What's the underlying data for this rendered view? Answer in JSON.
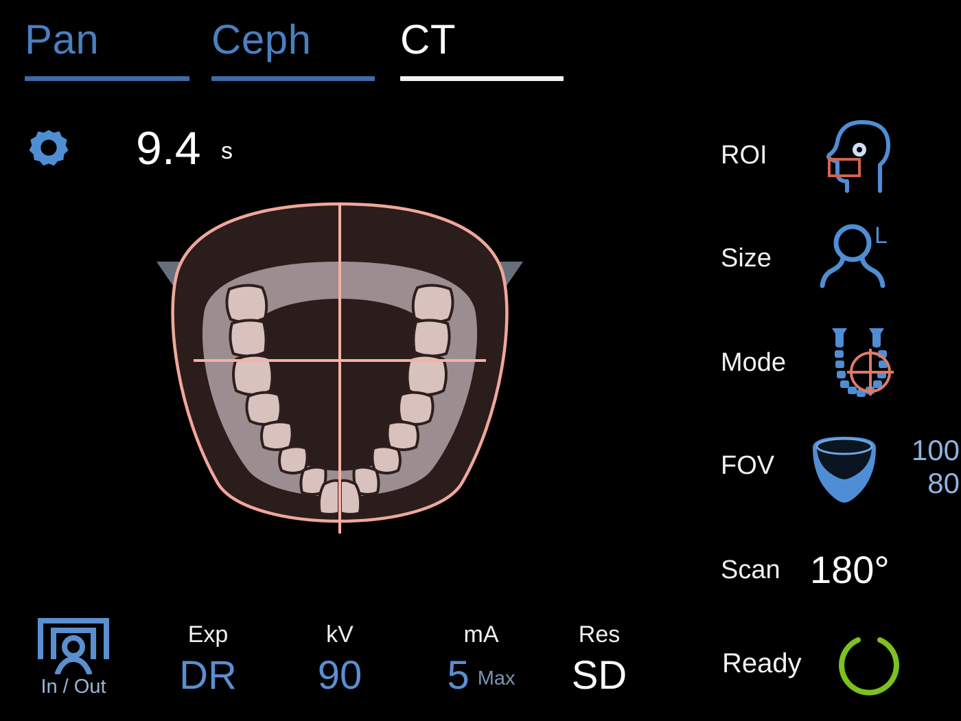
{
  "tabs": [
    {
      "label": "Pan",
      "active": false
    },
    {
      "label": "Ceph",
      "active": false
    },
    {
      "label": "CT",
      "active": true
    }
  ],
  "settings": {
    "gear_icon": "gear-icon",
    "exposure_time": "9.4",
    "exposure_unit": "s"
  },
  "arch": {
    "fov_outline_color": "#f0a79b",
    "fov_fill_color": "#2b1d1c",
    "gum_color": "#9c8d90",
    "tooth_fill_color": "#d9c2bd",
    "tooth_outline_color": "#2e1f1e",
    "wing_color": "#7b838f",
    "crosshair_color": "#f6b0a4"
  },
  "params": [
    {
      "key": "roi",
      "label": "ROI",
      "icon": "head-profile-roi-icon"
    },
    {
      "key": "size",
      "label": "Size",
      "icon": "patient-size-icon",
      "badge": "L"
    },
    {
      "key": "mode",
      "label": "Mode",
      "icon": "arch-target-mode-icon"
    },
    {
      "key": "fov",
      "label": "FOV",
      "icon": "fov-cylinder-icon",
      "value_h": "100",
      "value_v": "80"
    },
    {
      "key": "scan",
      "label": "Scan",
      "value": "180°"
    }
  ],
  "status": {
    "inout": {
      "label": "In / Out",
      "icon": "patient-in-out-icon"
    },
    "stats": [
      {
        "key": "exp",
        "label": "Exp",
        "value": "DR",
        "suffix": "",
        "color": "blue"
      },
      {
        "key": "kv",
        "label": "kV",
        "value": "90",
        "suffix": "",
        "color": "blue"
      },
      {
        "key": "ma",
        "label": "mA",
        "value": "5",
        "suffix": "Max",
        "color": "blue"
      },
      {
        "key": "res",
        "label": "Res",
        "value": "SD",
        "suffix": "",
        "color": "white"
      }
    ],
    "ready": {
      "label": "Ready",
      "icon": "power-ready-icon",
      "color": "#7cc11e"
    }
  },
  "colors": {
    "accent_blue": "#4a7fc1",
    "value_blue": "#5a8fd0",
    "white": "#ffffff",
    "ready_green": "#7cc11e",
    "salmon": "#f0a79b",
    "background": "#000000"
  }
}
